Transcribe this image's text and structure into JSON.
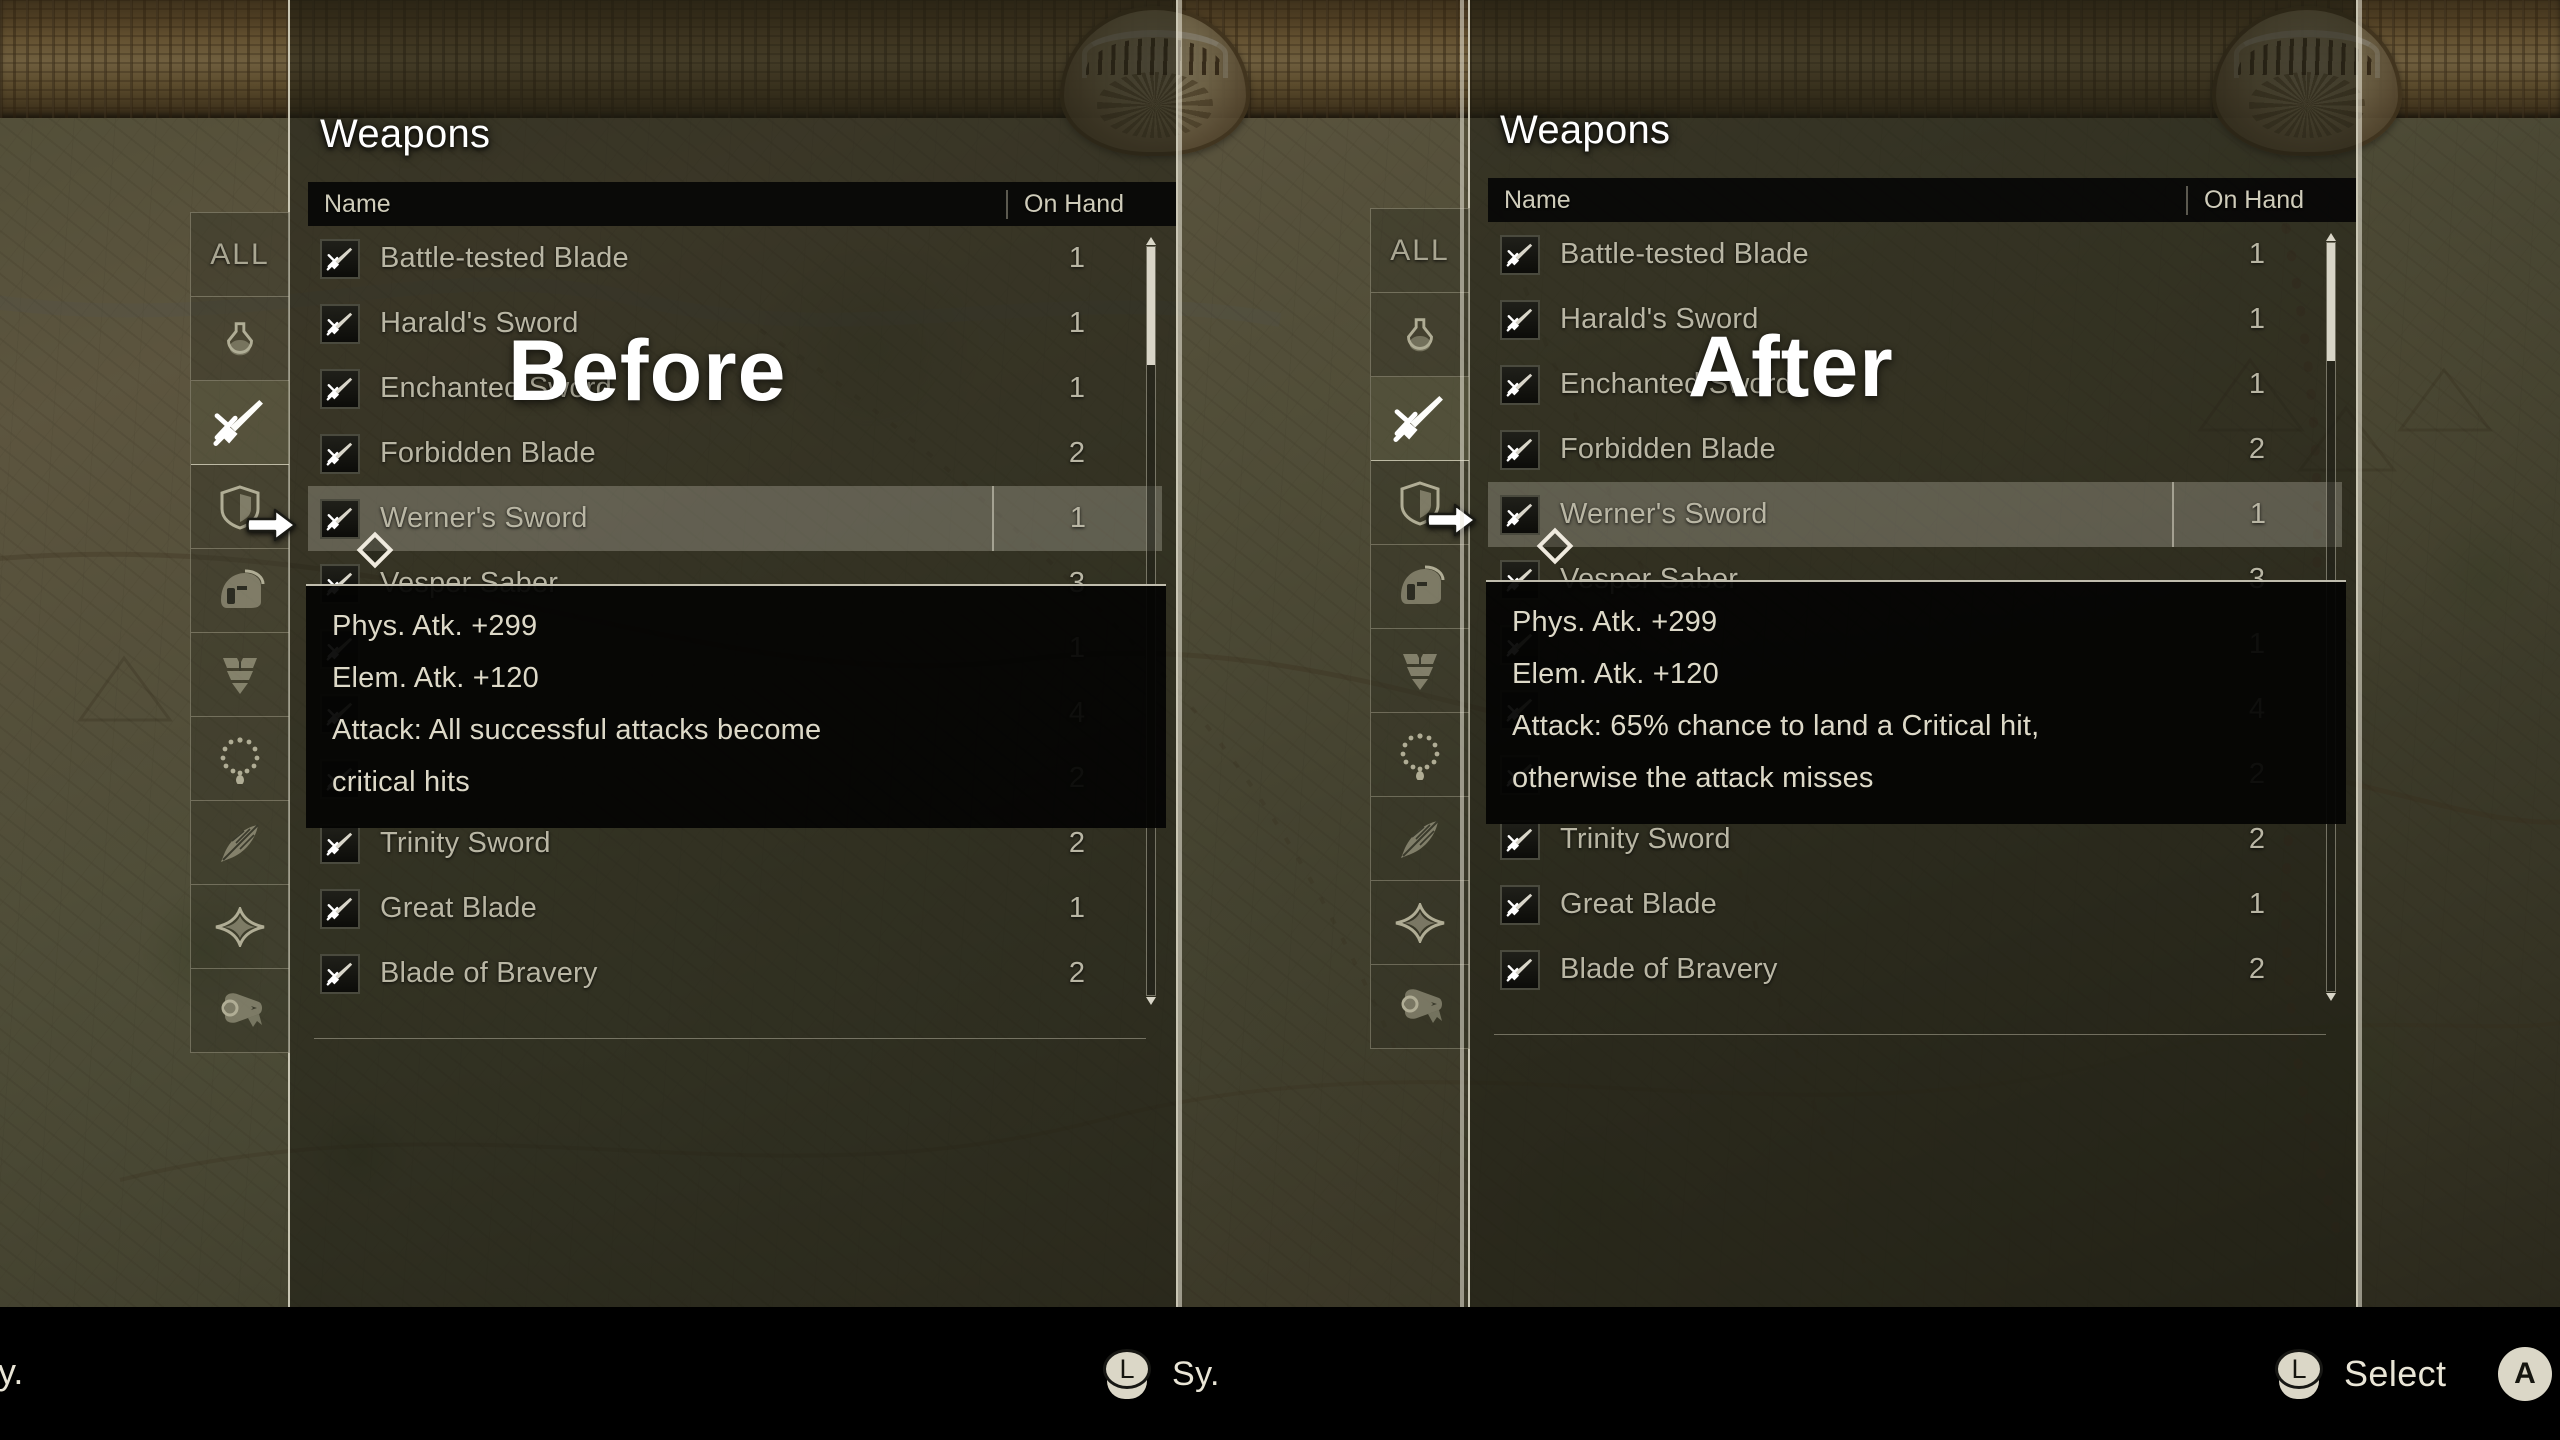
{
  "comparison": {
    "before_label": "Before",
    "after_label": "After"
  },
  "panel": {
    "title": "Weapons",
    "columns": {
      "name": "Name",
      "quantity": "On Hand"
    },
    "category_rail": {
      "items": [
        {
          "id": "all",
          "label": "ALL",
          "icon": "all-text-icon",
          "active": false
        },
        {
          "id": "consumable",
          "label": "",
          "icon": "flask-icon",
          "active": false
        },
        {
          "id": "weapon",
          "label": "",
          "icon": "sword-icon",
          "active": true
        },
        {
          "id": "shield",
          "label": "",
          "icon": "shield-icon",
          "active": false
        },
        {
          "id": "helmet",
          "label": "",
          "icon": "helmet-icon",
          "active": false
        },
        {
          "id": "armor",
          "label": "",
          "icon": "armor-icon",
          "active": false
        },
        {
          "id": "accessory",
          "label": "",
          "icon": "necklace-icon",
          "active": false
        },
        {
          "id": "quill",
          "label": "",
          "icon": "feather-icon",
          "active": false
        },
        {
          "id": "gem",
          "label": "",
          "icon": "sparkle-icon",
          "active": false
        },
        {
          "id": "scroll",
          "label": "",
          "icon": "scroll-icon",
          "active": false
        }
      ]
    },
    "rows": [
      {
        "name": "Battle-tested Blade",
        "qty": "1",
        "selected": false,
        "equipped": false
      },
      {
        "name": "Harald's Sword",
        "qty": "1",
        "selected": false,
        "equipped": false
      },
      {
        "name": "Enchanted Sword",
        "qty": "1",
        "selected": false,
        "equipped": false
      },
      {
        "name": "Forbidden Blade",
        "qty": "2",
        "selected": false,
        "equipped": false
      },
      {
        "name": "Werner's Sword",
        "qty": "1",
        "selected": true,
        "equipped": false
      },
      {
        "name": "Vesper Saber",
        "qty": "3",
        "selected": false,
        "equipped": true
      },
      {
        "name": "",
        "qty": "1",
        "selected": false,
        "equipped": false
      },
      {
        "name": "",
        "qty": "4",
        "selected": false,
        "equipped": false
      },
      {
        "name": "",
        "qty": "2",
        "selected": false,
        "equipped": false
      },
      {
        "name": "Trinity Sword",
        "qty": "2",
        "selected": false,
        "equipped": false
      },
      {
        "name": "Great Blade",
        "qty": "1",
        "selected": false,
        "equipped": false
      },
      {
        "name": "Blade of Bravery",
        "qty": "2",
        "selected": false,
        "equipped": false
      }
    ]
  },
  "tooltip_before": {
    "lines": [
      "Phys. Atk. +299",
      "Elem. Atk. +120",
      "Attack: All successful attacks become",
      "critical hits"
    ]
  },
  "tooltip_after": {
    "lines": [
      "Phys. Atk. +299",
      "Elem. Atk. +120",
      "Attack: 65% chance to land a Critical hit,",
      "otherwise the attack misses"
    ]
  },
  "command_bar": {
    "left_cut_text": "ry.",
    "middle": {
      "button": "L",
      "label": "Sy."
    },
    "right": {
      "button": "L",
      "label": "Select"
    },
    "far_right_button": "A"
  },
  "colors": {
    "panel_overlay": "#1a1a12",
    "header_row": "#060605",
    "text_primary": "#ffffff",
    "text_muted": "#b9b6a4",
    "tooltip_bg": "#040403",
    "selection": "#d7d4c4",
    "command_bar_bg": "#000000"
  }
}
